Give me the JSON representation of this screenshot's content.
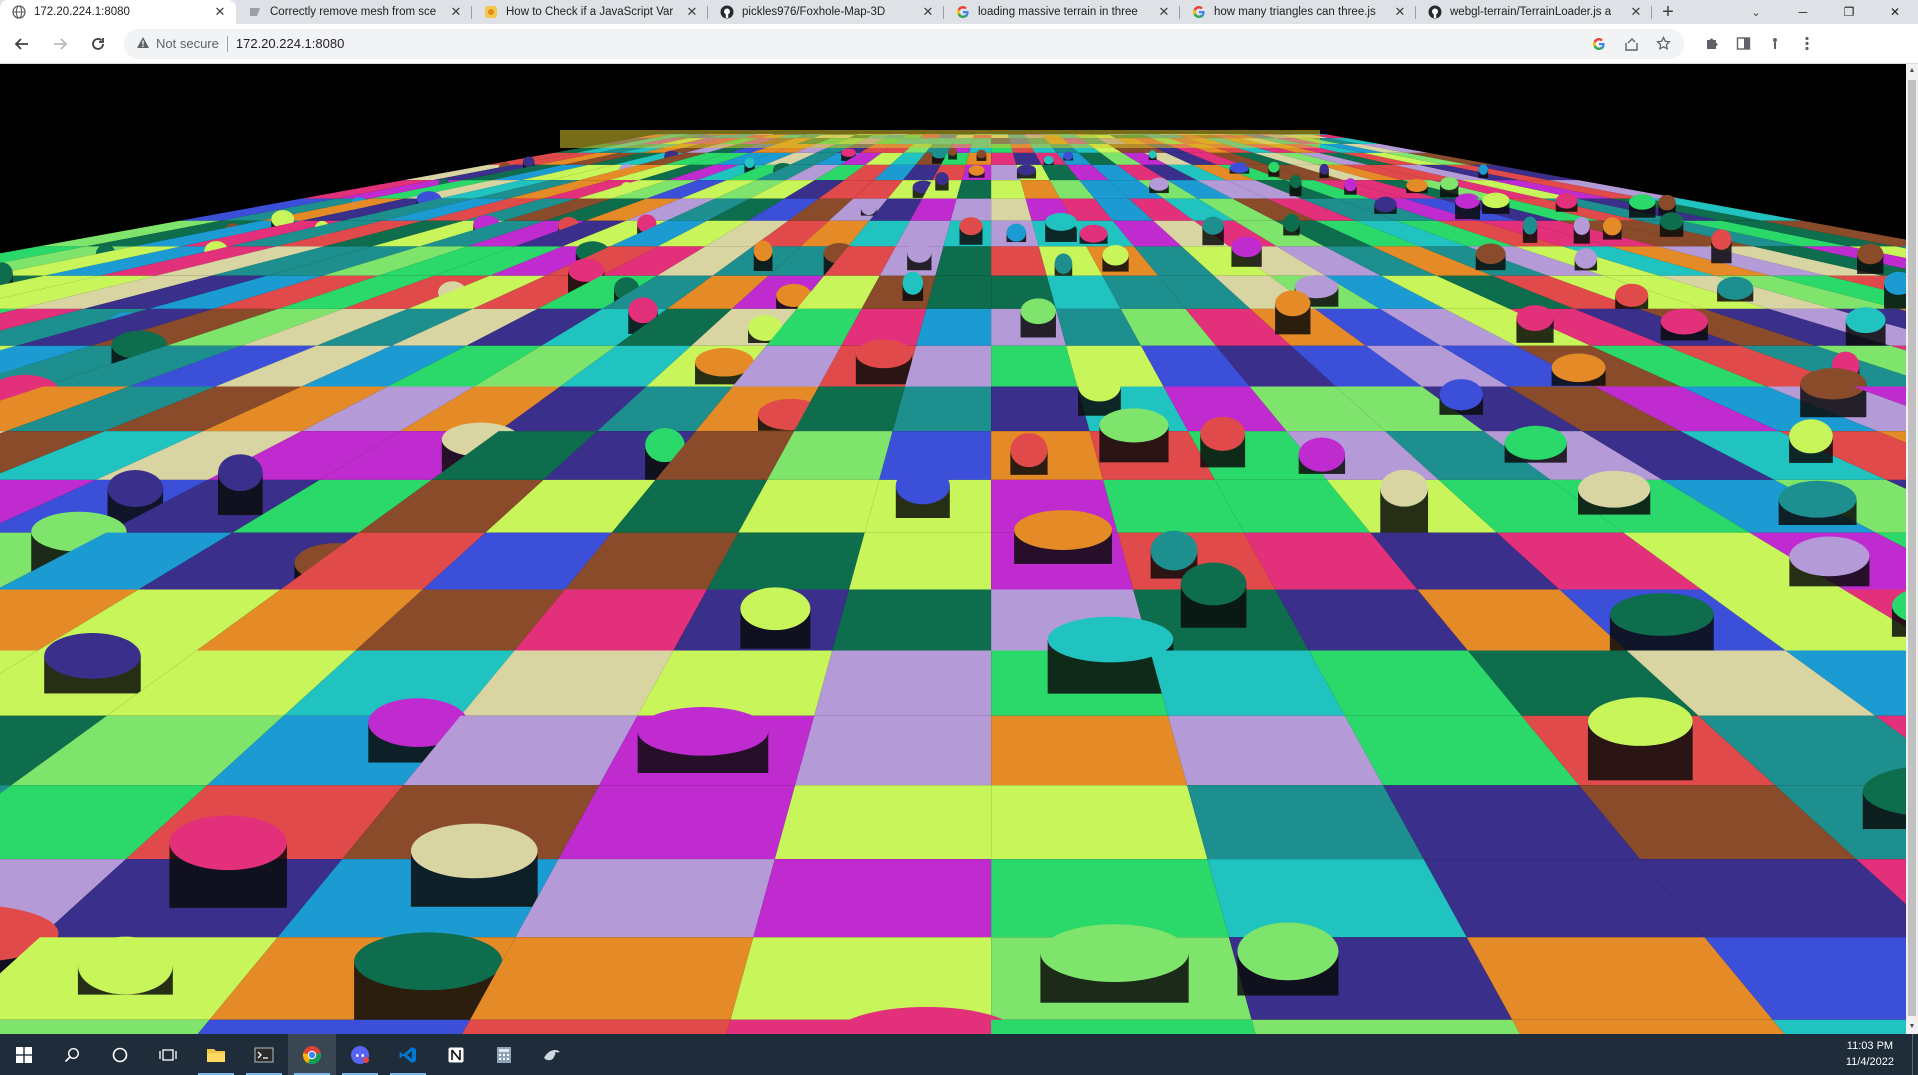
{
  "browser": {
    "tabs": [
      {
        "title": "172.20.224.1:8080",
        "icon": "globe-icon",
        "active": true
      },
      {
        "title": "Correctly remove mesh from sce",
        "icon": "page-icon",
        "active": false
      },
      {
        "title": "How to Check if a JavaScript Var",
        "icon": "stackexchange-icon",
        "active": false
      },
      {
        "title": "pickles976/Foxhole-Map-3D",
        "icon": "github-icon",
        "active": false
      },
      {
        "title": "loading massive terrain in three",
        "icon": "google-icon",
        "active": false
      },
      {
        "title": "how many triangles can three.js",
        "icon": "google-icon",
        "active": false
      },
      {
        "title": "webgl-terrain/TerrainLoader.js a",
        "icon": "github-icon",
        "active": false
      }
    ],
    "security_label": "Not secure",
    "url": "172.20.224.1:8080",
    "colors": {
      "tabstrip": "#dee1e6",
      "toolbar": "#ffffff",
      "omnibox": "#f1f3f4"
    }
  },
  "scene": {
    "description_colors": [
      "#1e8f8f",
      "#c02bd0",
      "#2ad96a",
      "#e48a27",
      "#3b4fd8",
      "#d9d5a3",
      "#e3307a",
      "#7fe46b",
      "#1b9bd1",
      "#b49bd8",
      "#0e6d4d",
      "#e04a4a",
      "#3a2f8a",
      "#c7f55a",
      "#20c3c0",
      "#8a4b2b"
    ]
  },
  "taskbar": {
    "apps": [
      "windows-start-icon",
      "search-icon",
      "cortana-icon",
      "task-view-icon",
      "file-explorer-icon",
      "terminal-icon",
      "chrome-icon",
      "discord-icon",
      "vscode-icon",
      "notion-icon",
      "calculator-icon",
      "bird-app-icon"
    ],
    "time": "11:03 PM",
    "date": "11/4/2022"
  }
}
